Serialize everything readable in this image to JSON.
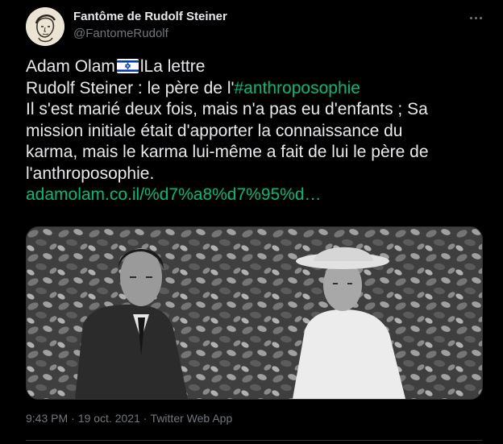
{
  "author": {
    "display_name": "Fantôme de Rudolf Steiner",
    "handle": "@FantomeRudolf",
    "avatar_icon": "portrait-sketch-icon"
  },
  "tweet": {
    "line1_prefix": "Adam Olam",
    "line1_flag_icon": "israel-flag-icon",
    "line1_suffix": "lLa lettre",
    "line2_prefix": "Rudolf Steiner : le père de l'",
    "hashtag": "#anthroposophie",
    "line3": "Il s'est marié deux fois, mais n'a pas eu d'enfants ; Sa",
    "line4": "mission initiale était d'apporter la connaissance du",
    "line5": "karma, mais le karma lui-même a fait de lui le père de",
    "line6": "l'anthroposophie.",
    "link": "adamolam.co.il/%d7%a8%d7%95%d…"
  },
  "media": {
    "description_icon": "photo-man-and-woman-icon"
  },
  "meta": {
    "time": "9:43 PM",
    "separator": "·",
    "date": "19 oct. 2021",
    "app": "Twitter Web App"
  },
  "colors": {
    "background": "#000000",
    "text": "#e7e9ea",
    "secondary": "#71767b",
    "accent": "#00ba7c"
  }
}
